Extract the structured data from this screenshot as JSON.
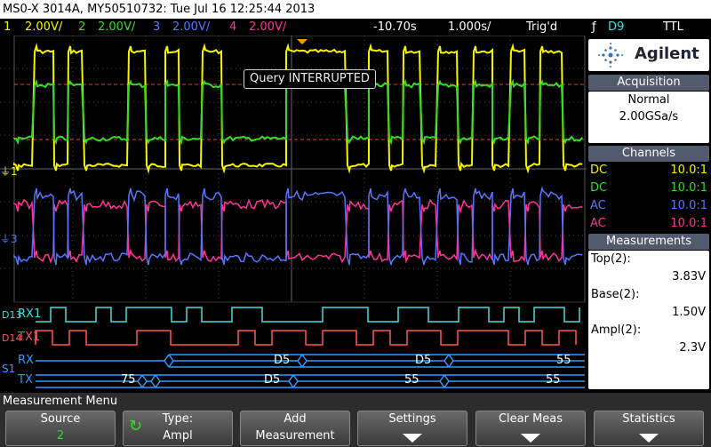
{
  "title": "MS0-X 3014A, MY50510732: Tue Jul 16 12:25:44 2013",
  "channel_bar": {
    "ch1_num": "1",
    "ch1_scale": "2.00V/",
    "ch2_num": "2",
    "ch2_scale": "2.00V/",
    "ch3_num": "3",
    "ch3_scale": "2.00V/",
    "ch4_num": "4",
    "ch4_scale": "2.00V/",
    "delay": "-10.70s",
    "timebase": "1.000s/",
    "trigger_status": "Trig'd",
    "trigger_source": "D9",
    "trigger_level": "TTL"
  },
  "popup": "Query INTERRUPTED",
  "logo": "Agilent",
  "acquisition": {
    "header": "Acquisition",
    "mode": "Normal",
    "rate": "2.00GSa/s"
  },
  "channels": {
    "header": "Channels",
    "rows": [
      {
        "coupling": "DC",
        "probe": "10.0:1",
        "color": "#f5f500"
      },
      {
        "coupling": "DC",
        "probe": "10.0:1",
        "color": "#33dd22"
      },
      {
        "coupling": "AC",
        "probe": "10.0:1",
        "color": "#5577ff"
      },
      {
        "coupling": "AC",
        "probe": "10.0:1",
        "color": "#ff3399"
      }
    ]
  },
  "measurements": {
    "header": "Measurements",
    "items": [
      {
        "label": "Top(2):",
        "value": "3.83V"
      },
      {
        "label": "Base(2):",
        "value": "1.50V"
      },
      {
        "label": "Ampl(2):",
        "value": "2.3V"
      }
    ]
  },
  "digital": {
    "rx_label": "RX1",
    "tx_label": "TX1",
    "d_rx": "D13",
    "d_tx": "D14"
  },
  "serial": {
    "bus": "S1",
    "rx_label": "RX",
    "tx_label": "TX",
    "rx_values": [
      "D5",
      "D5",
      "55"
    ],
    "tx_values": [
      "75",
      "D5",
      "55",
      "55"
    ]
  },
  "markers": {
    "ch1": "1",
    "ch3": "3"
  },
  "menu": {
    "title": "Measurement Menu",
    "source_label": "Source",
    "source_value": "2",
    "type_label": "Type:",
    "type_value": "Ampl",
    "add_label1": "Add",
    "add_label2": "Measurement",
    "settings_label": "Settings",
    "clear_label": "Clear Meas",
    "stats_label": "Statistics"
  },
  "colors": {
    "ch1": "#f5f500",
    "ch2": "#33dd22",
    "ch3": "#5577ff",
    "ch4": "#ff3399",
    "digital_rx": "#44dddd",
    "digital_tx": "#ff5555",
    "serial": "#3399ff"
  }
}
